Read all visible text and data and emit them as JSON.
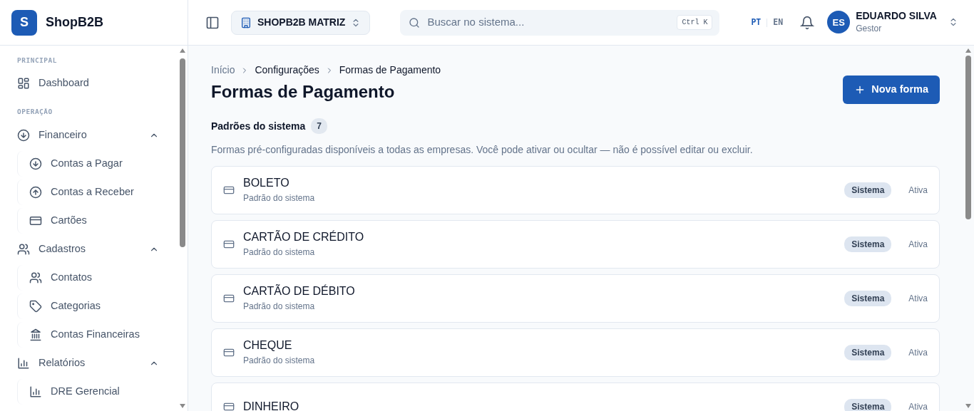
{
  "sidebar": {
    "brand": {
      "initial": "S",
      "name": "ShopB2B"
    },
    "sections": [
      {
        "label": "PRINCIPAL",
        "items": [
          {
            "label": "Dashboard"
          }
        ]
      },
      {
        "label": "OPERAÇÃO",
        "items": [
          {
            "label": "Financeiro",
            "expanded": true,
            "children": [
              {
                "label": "Contas a Pagar"
              },
              {
                "label": "Contas a Receber"
              },
              {
                "label": "Cartões"
              }
            ]
          },
          {
            "label": "Cadastros",
            "expanded": true,
            "children": [
              {
                "label": "Contatos"
              },
              {
                "label": "Categorias"
              },
              {
                "label": "Contas Financeiras"
              }
            ]
          },
          {
            "label": "Relatórios",
            "expanded": true,
            "children": [
              {
                "label": "DRE Gerencial"
              }
            ]
          }
        ]
      }
    ]
  },
  "header": {
    "company": "SHOPB2B MATRIZ",
    "search": {
      "placeholder": "Buscar no sistema...",
      "shortcut": "Ctrl K"
    },
    "languages": [
      {
        "label": "PT",
        "selected": true
      },
      {
        "label": "EN",
        "selected": false
      }
    ],
    "user": {
      "initials": "ES",
      "name": "EDUARDO SILVA",
      "role": "Gestor"
    }
  },
  "breadcrumb": [
    "Início",
    "Configurações",
    "Formas de Pagamento"
  ],
  "title": "Formas de Pagamento",
  "new_button": "Nova forma",
  "section": {
    "title": "Padrões do sistema",
    "count": "7",
    "description": "Formas pré-configuradas disponíveis a todas as empresas. Você pode ativar ou ocultar — não é possível editar ou excluir."
  },
  "methods": [
    {
      "name": "BOLETO",
      "subtitle": "Padrão do sistema",
      "badge": "Sistema",
      "status": "Ativa"
    },
    {
      "name": "CARTÃO DE CRÉDITO",
      "subtitle": "Padrão do sistema",
      "badge": "Sistema",
      "status": "Ativa"
    },
    {
      "name": "CARTÃO DE DÉBITO",
      "subtitle": "Padrão do sistema",
      "badge": "Sistema",
      "status": "Ativa"
    },
    {
      "name": "CHEQUE",
      "subtitle": "Padrão do sistema",
      "badge": "Sistema",
      "status": "Ativa"
    },
    {
      "name": "DINHEIRO",
      "badge": "Sistema",
      "status": "Ativa"
    }
  ]
}
